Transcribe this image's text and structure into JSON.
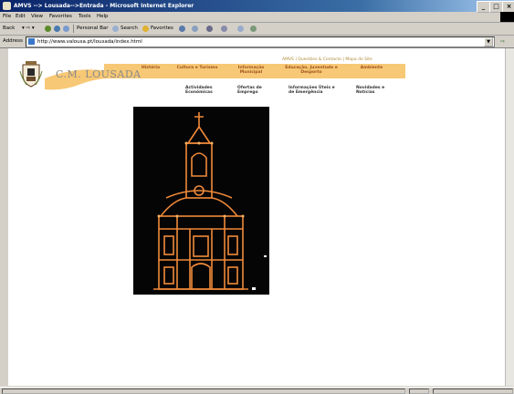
{
  "window": {
    "title": "AMVS --> Lousada-->Entrada - Microsoft Internet Explorer"
  },
  "menu": [
    "File",
    "Edit",
    "View",
    "Favorites",
    "Tools",
    "Help"
  ],
  "toolbar": {
    "back": "Back",
    "personal_bar": "Personal Bar",
    "search": "Search",
    "favorites": "Favorites"
  },
  "address": {
    "label": "Address",
    "url": "http://www.valousa.pt/lousada/index.html"
  },
  "site": {
    "title": "C.M. LOUSADA",
    "utility": "AMVS | Questões & Contacto | Mapa do Site",
    "nav_primary": [
      "História",
      "Cultura e Turismo",
      "Informação Municipal",
      "Educação, Juventude e Desporto",
      "Ambiente"
    ],
    "nav_secondary": [
      "Actividades Económicas",
      "Ofertas de Emprego",
      "Informações Úteis e de Emergência",
      "Novidades e Notícias"
    ]
  },
  "colors": {
    "band": "#f7c875",
    "nav_text": "#a0521c",
    "title_text": "#8a8a8a"
  }
}
